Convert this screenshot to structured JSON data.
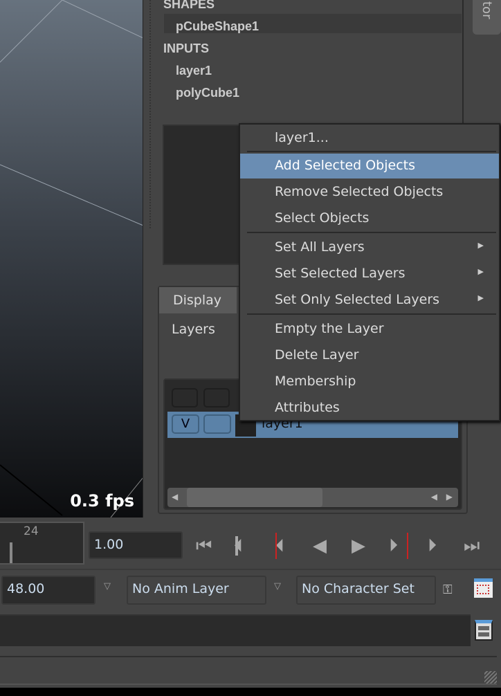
{
  "viewport": {
    "fps": "0.3 fps"
  },
  "channel_box": {
    "sections": [
      {
        "label": "SHAPES",
        "items": [
          "pCubeShape1"
        ]
      },
      {
        "label": "INPUTS",
        "items": [
          "layer1",
          "polyCube1"
        ]
      }
    ],
    "side_tab": "tor"
  },
  "layer_editor": {
    "tab": "Display",
    "subtab": "Layers",
    "layers": [
      {
        "visible": "V",
        "name": "layer1"
      }
    ]
  },
  "context_menu": {
    "items": [
      {
        "label": "layer1..."
      },
      {
        "label": "Add Selected Objects",
        "highlighted": true
      },
      {
        "label": "Remove Selected Objects"
      },
      {
        "label": "Select Objects"
      },
      {
        "label": "Set All Layers",
        "submenu": true
      },
      {
        "label": "Set Selected Layers",
        "submenu": true
      },
      {
        "label": "Set Only Selected Layers",
        "submenu": true
      },
      {
        "label": "Empty the Layer"
      },
      {
        "label": "Delete Layer"
      },
      {
        "label": "Membership"
      },
      {
        "label": "Attributes"
      }
    ]
  },
  "timeline": {
    "tick_label": "24",
    "current_time": "1.00",
    "end_time": "48.00",
    "anim_layer": "No Anim Layer",
    "character_set": "No Character Set"
  },
  "playback": [
    "go-to-start",
    "step-back-frame",
    "step-back-key",
    "play-backward",
    "play-forward",
    "step-forward-key",
    "step-forward-frame",
    "go-to-end"
  ],
  "colors": {
    "highlight": "#6a8db3",
    "layer_row": "#5b82a8",
    "key_marker": "#cc2222"
  }
}
